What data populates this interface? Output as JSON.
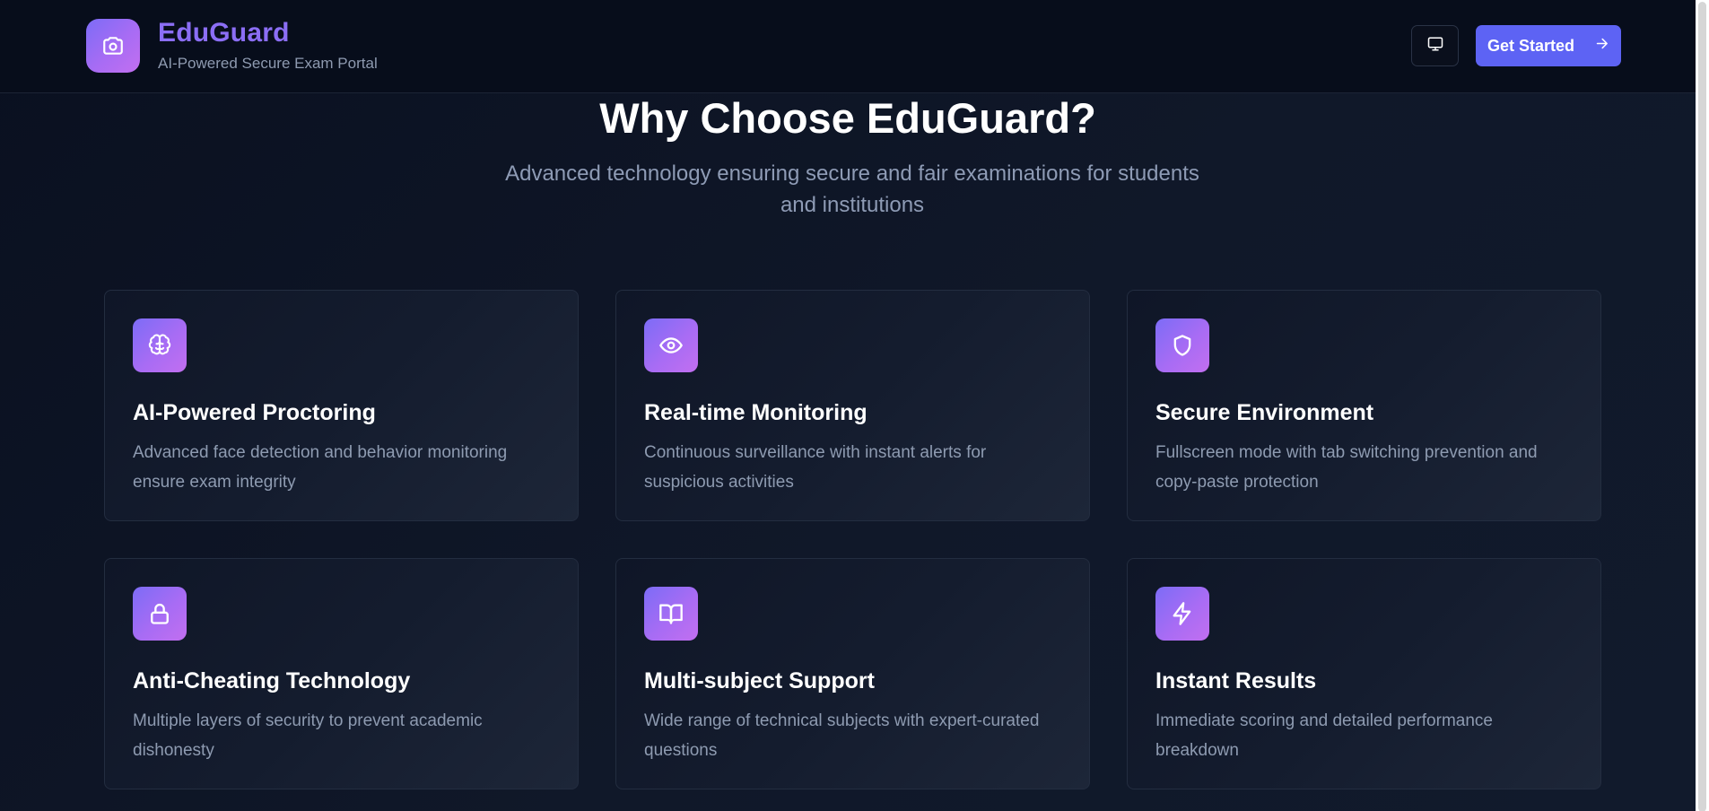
{
  "header": {
    "brand_title": "EduGuard",
    "brand_subtitle": "AI-Powered Secure Exam Portal",
    "logo_icon": "camera-icon",
    "monitor_button_icon": "monitor-icon",
    "cta_label": "Get Started",
    "cta_icon": "arrow-right-icon"
  },
  "hero": {
    "title": "Why Choose EduGuard?",
    "subtitle": "Advanced technology ensuring secure and fair examinations for students and institutions"
  },
  "features": [
    {
      "icon": "brain-icon",
      "title": "AI-Powered Proctoring",
      "description": "Advanced face detection and behavior monitoring ensure exam integrity"
    },
    {
      "icon": "eye-icon",
      "title": "Real-time Monitoring",
      "description": "Continuous surveillance with instant alerts for suspicious activities"
    },
    {
      "icon": "shield-icon",
      "title": "Secure Environment",
      "description": "Fullscreen mode with tab switching prevention and copy-paste protection"
    },
    {
      "icon": "lock-icon",
      "title": "Anti-Cheating Technology",
      "description": "Multiple layers of security to prevent academic dishonesty"
    },
    {
      "icon": "book-open-icon",
      "title": "Multi-subject Support",
      "description": "Wide range of technical subjects with expert-curated questions"
    },
    {
      "icon": "lightning-icon",
      "title": "Instant Results",
      "description": "Immediate scoring and detailed performance breakdown"
    }
  ],
  "colors": {
    "accent": "#5d63f4",
    "brand_text": "#8b6ef5",
    "icon_gradient_start": "#7c6cf6",
    "icon_gradient_end": "#c26ff0",
    "background": "#0e1424"
  }
}
